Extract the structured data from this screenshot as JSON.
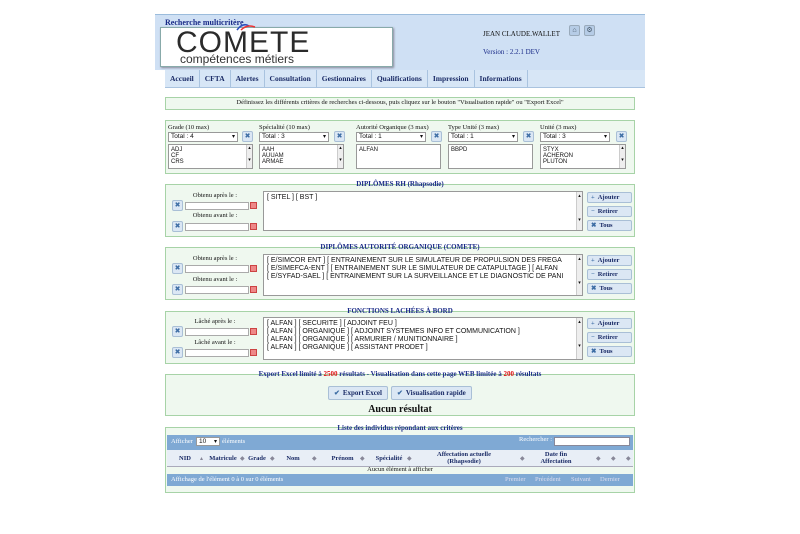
{
  "header": {
    "subtitle": "Recherche multicritère",
    "logo_big": "COMETE",
    "logo_small": "compétences métiers",
    "user": "JEAN CLAUDE.WALLET",
    "version": "Version : 2.2.1 DEV"
  },
  "nav": [
    "Accueil",
    "CFTA",
    "Alertes",
    "Consultation",
    "Gestionnaires",
    "Qualifications",
    "Impression",
    "Informations"
  ],
  "instruction": "Définissez les différents critères de recherches ci-dessous, puis cliquez sur le bouton \"Visualisation rapide\" ou \"Export Excel\"",
  "filters": [
    {
      "label": "Grade (10 max)",
      "select": "Total : 4",
      "items": [
        "ADJ",
        "CF",
        "CRS"
      ]
    },
    {
      "label": "Spécialité (10 max)",
      "select": "Total : 3",
      "items": [
        "AAH",
        "AUUAM",
        "ARMAE"
      ]
    },
    {
      "label": "Autorité Organique (3 max)",
      "select": "Total : 1",
      "items": [
        "ALFAN"
      ]
    },
    {
      "label": "Type Unité (3 max)",
      "select": "Total : 1",
      "items": [
        "BBPD"
      ]
    },
    {
      "label": "Unité (3 max)",
      "select": "Total : 3",
      "items": [
        "STYX",
        "ACHERON",
        "PLUTON"
      ]
    }
  ],
  "sections": [
    {
      "title": "DIPLÔMES RH (Rhapsodie)",
      "date1": "Obtenu après le :",
      "date2": "Obtenu avant le :",
      "lines": [
        "[ SITEL ] [ BST ]"
      ]
    },
    {
      "title": "DIPLÔMES AUTORITÉ ORGANIQUE (COMETE)",
      "date1": "Obtenu après le :",
      "date2": "Obtenu avant le :",
      "lines": [
        "[ E/SIMCOR ENT ] [ ENTRAINEMENT SUR LE SIMULATEUR DE PROPULSION DES FREGA",
        "[ E/SIMEFCA-ENT ] [ ENTRAINEMENT SUR LE SIMULATEUR DE CATAPULTAGE ] [ ALFAN",
        "[ E/SYFAD-SAEL ] [ ENTRAINEMENT SUR LA SURVEILLANCE ET LE DIAGNOSTIC DE PANI"
      ]
    },
    {
      "title": "FONCTIONS LACHÉES À BORD",
      "date1": "Lâché après le :",
      "date2": "Lâché avant le :",
      "lines": [
        "[ ALFAN ] [ SECURITE ] [ ADJOINT FEU ]",
        "[ ALFAN ] [ ORGANIQUE ] [ ADJOINT SYSTEMES INFO ET COMMUNICATION ]",
        "[ ALFAN ] [ ORGANIQUE ] [ ARMURIER / MUNITIONNAIRE ]",
        "[ ALFAN ] [ ORGANIQUE ] [ ASSISTANT PRODET ]"
      ]
    }
  ],
  "side_buttons": {
    "add": "Ajouter",
    "remove": "Retirer",
    "all": "Tous"
  },
  "export": {
    "p1": "Export Excel limité à ",
    "n1": "2500",
    "p2": " résultats - Visualisation dans cette page WEB limitée à ",
    "n2": "200",
    "p3": " résultats",
    "btn_excel": "Export Excel",
    "btn_visu": "Visualisation rapide"
  },
  "no_result": "Aucun résultat",
  "list_title": "Liste des individus répondant aux critères",
  "table": {
    "show_label": "Afficher",
    "show_value": "10",
    "elements": "éléments",
    "search_label": "Rechercher :",
    "columns": [
      "NID",
      "Matricule",
      "Grade",
      "Nom",
      "Prénom",
      "Spécialité",
      "Affectation actuelle (Rhapsodie)",
      "Date fin Affectation",
      "",
      ""
    ],
    "empty": "Aucun élément à afficher",
    "info": "Affichage de l'élément 0 à 0 sur 0 éléments",
    "pager": [
      "Premier",
      "Précédent",
      "Suivant",
      "Dernier"
    ]
  }
}
